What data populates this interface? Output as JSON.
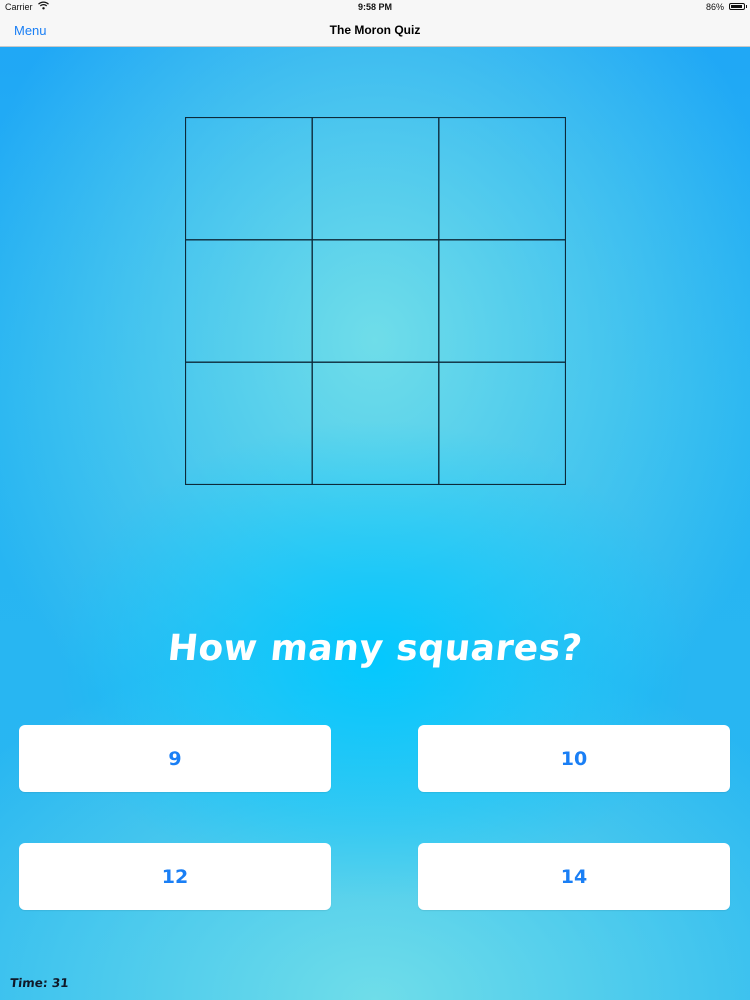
{
  "status_bar": {
    "carrier": "Carrier",
    "time": "9:58 PM",
    "battery": "86%",
    "wifi_icon": "wifi-icon",
    "battery_icon": "battery-icon"
  },
  "nav": {
    "menu_label": "Menu",
    "title": "The Moron Quiz"
  },
  "puzzle": {
    "rows": 3,
    "cols": 3
  },
  "question": "How many squares?",
  "answers": [
    "9",
    "10",
    "12",
    "14"
  ],
  "timer": {
    "label": "Time: 31"
  },
  "colors": {
    "accent": "#1a7ff5",
    "background": "#2ab8f1",
    "grid_line": "#0d2a3a"
  }
}
